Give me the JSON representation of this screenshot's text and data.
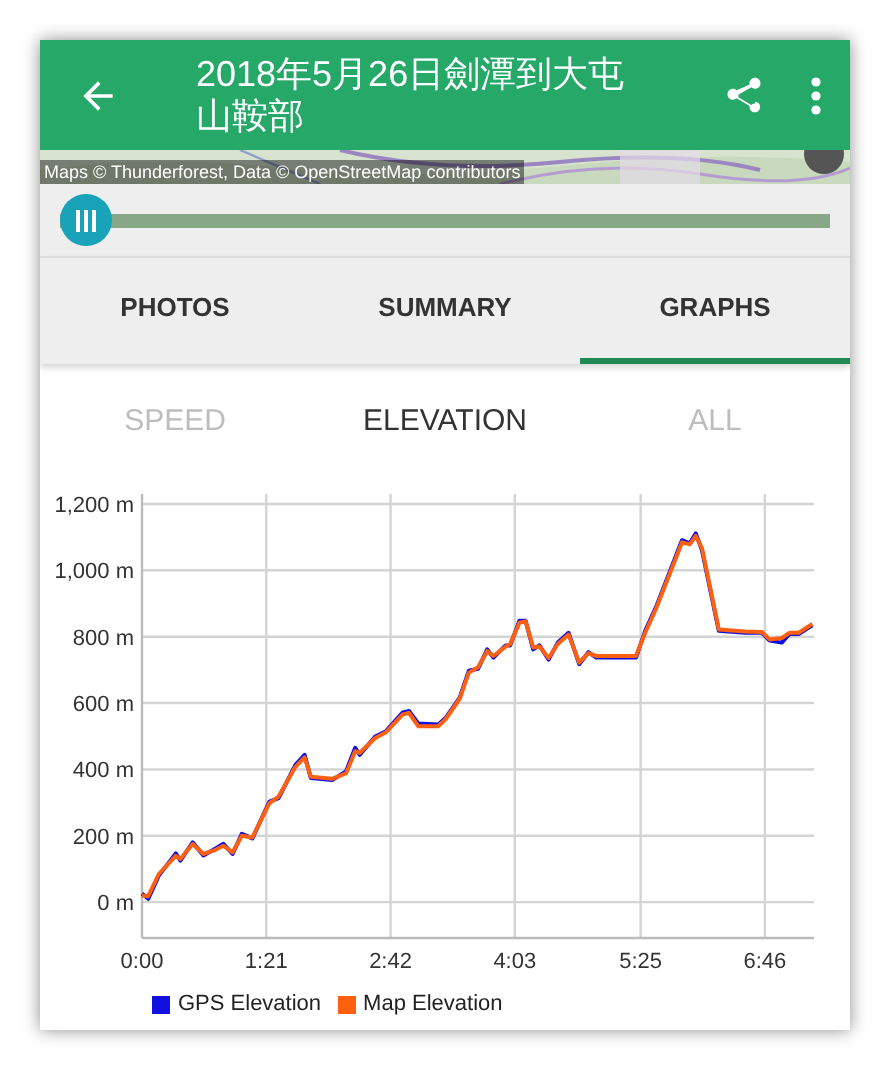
{
  "app_bar": {
    "title": "2018年5月26日劍潭到大屯山鞍部"
  },
  "map": {
    "kind": "picture",
    "attribution": "Maps © Thunderforest, Data © OpenStreetMap contributors"
  },
  "tabs": [
    {
      "label": "PHOTOS",
      "selected": false
    },
    {
      "label": "SUMMARY",
      "selected": false
    },
    {
      "label": "GRAPHS",
      "selected": true
    }
  ],
  "graph_tabs": [
    {
      "label": "SPEED",
      "selected": false
    },
    {
      "label": "ELEVATION",
      "selected": true
    },
    {
      "label": "ALL",
      "selected": false
    }
  ],
  "chart_data": {
    "type": "line",
    "x": [
      0,
      4,
      11,
      22,
      25,
      33,
      40,
      48,
      53,
      59,
      65,
      72,
      83,
      89,
      100,
      106,
      110,
      124,
      133,
      139,
      142,
      152,
      159,
      170,
      174,
      180,
      193,
      198,
      207,
      213,
      219,
      225,
      229,
      237,
      240,
      246,
      250,
      255,
      259,
      265,
      271,
      278,
      285,
      291,
      296,
      322,
      328,
      335,
      341,
      352,
      357,
      361,
      365,
      376,
      393,
      404,
      409,
      417,
      422,
      428,
      437
    ],
    "series": [
      {
        "name": "GPS Elevation",
        "color": "#1010e0",
        "values": [
          26,
          10,
          80,
          147,
          125,
          180,
          141,
          162,
          176,
          145,
          206,
          192,
          303,
          313,
          414,
          444,
          374,
          368,
          394,
          465,
          444,
          499,
          515,
          572,
          576,
          539,
          535,
          556,
          616,
          697,
          703,
          762,
          737,
          774,
          774,
          848,
          848,
          762,
          774,
          731,
          782,
          812,
          717,
          753,
          737,
          737,
          818,
          889,
          960,
          1091,
          1081,
          1111,
          1060,
          818,
          812,
          812,
          788,
          782,
          808,
          808,
          834
        ]
      },
      {
        "name": "Map Elevation",
        "color": "#ff6010",
        "values": [
          20,
          18,
          85,
          140,
          130,
          175,
          145,
          158,
          170,
          150,
          200,
          195,
          298,
          318,
          408,
          436,
          378,
          372,
          388,
          455,
          450,
          495,
          512,
          566,
          570,
          530,
          530,
          552,
          612,
          692,
          708,
          756,
          742,
          770,
          778,
          842,
          846,
          768,
          770,
          736,
          778,
          806,
          722,
          750,
          742,
          742,
          812,
          884,
          955,
          1084,
          1078,
          1104,
          1066,
          822,
          816,
          814,
          792,
          796,
          812,
          812,
          838
        ]
      }
    ],
    "xlim": [
      0,
      438
    ],
    "ylim": [
      -108,
      1230
    ],
    "grid": true,
    "legend": true,
    "xticks": [
      {
        "value": 0,
        "label": "0:00"
      },
      {
        "value": 81,
        "label": "1:21"
      },
      {
        "value": 162,
        "label": "2:42"
      },
      {
        "value": 243,
        "label": "4:03"
      },
      {
        "value": 325,
        "label": "5:25"
      },
      {
        "value": 406,
        "label": "6:46"
      }
    ],
    "yticks": [
      {
        "value": 0,
        "label": "0 m"
      },
      {
        "value": 200,
        "label": "200 m"
      },
      {
        "value": 400,
        "label": "400 m"
      },
      {
        "value": 600,
        "label": "600 m"
      },
      {
        "value": 800,
        "label": "800 m"
      },
      {
        "value": 1000,
        "label": "1,000 m"
      },
      {
        "value": 1200,
        "label": "1,200 m"
      }
    ]
  }
}
